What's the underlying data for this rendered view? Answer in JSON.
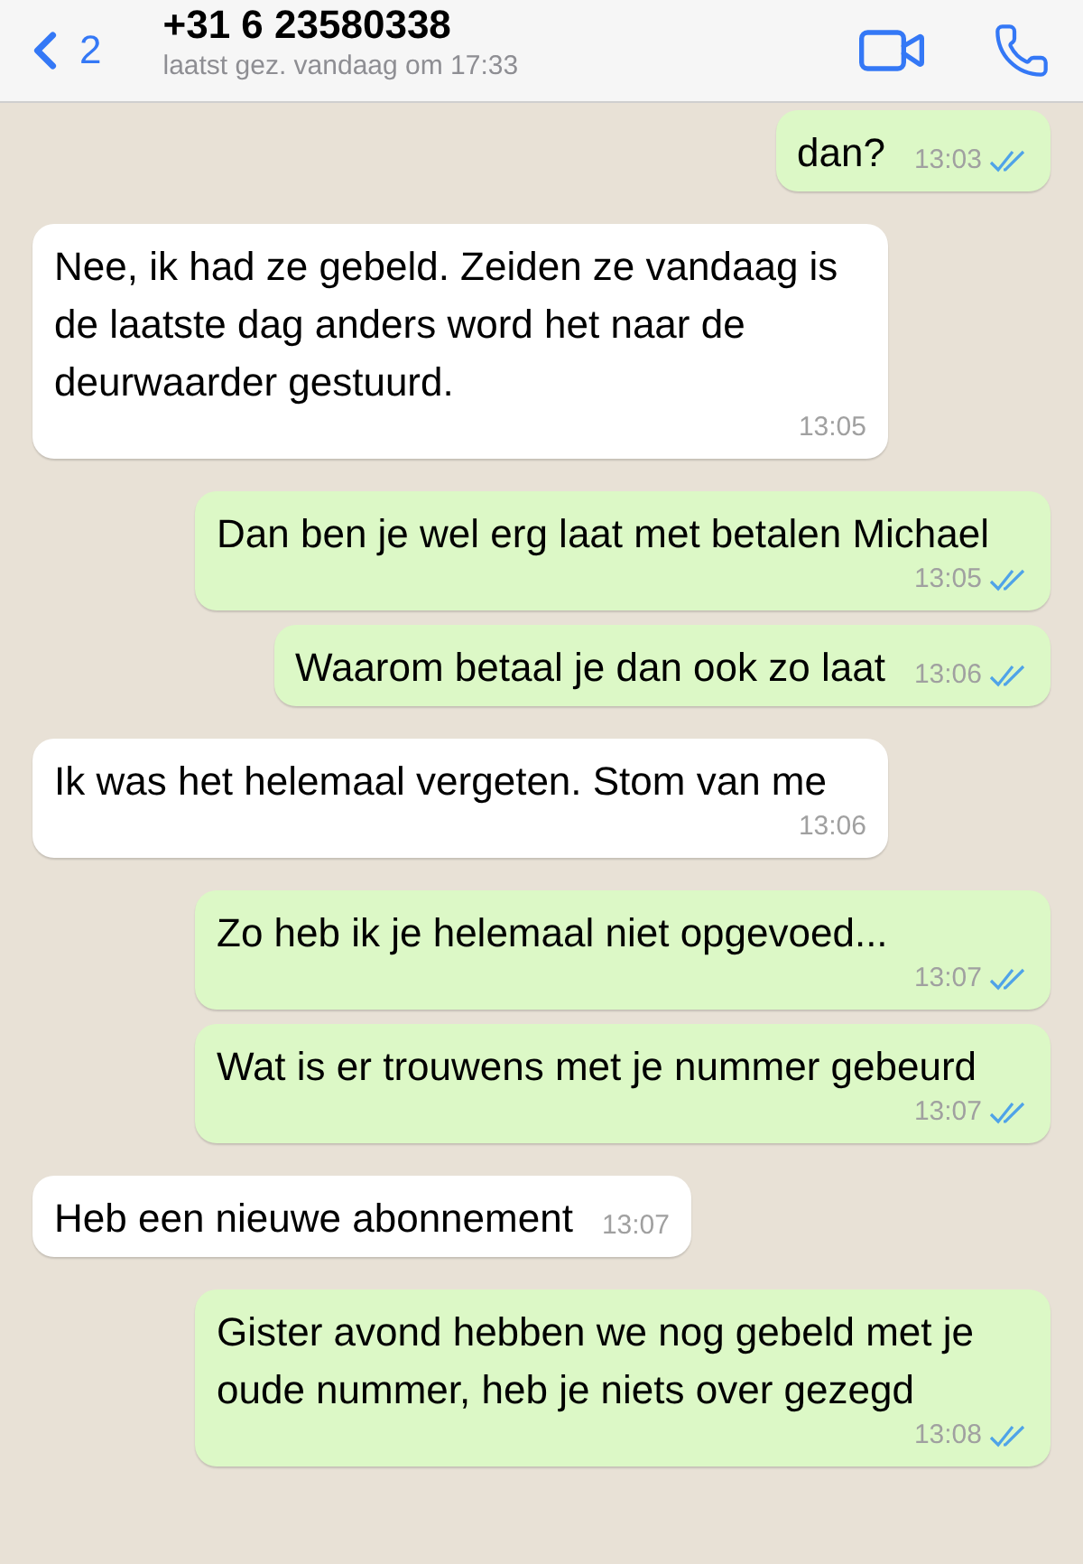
{
  "header": {
    "back_count": "2",
    "contact": "+31 6 23580338",
    "last_seen": "laatst gez. vandaag om 17:33"
  },
  "messages": [
    {
      "kind": "outgoing",
      "text": "dan?",
      "time": "13:03",
      "read": true
    },
    {
      "kind": "incoming",
      "text": "Nee, ik had ze gebeld. Zeiden ze vandaag is de laatste dag anders word het naar de deurwaarder gestuurd.",
      "time": "13:05"
    },
    {
      "kind": "outgoing",
      "text": "Dan ben je wel erg laat met betalen Michael",
      "time": "13:05",
      "read": true
    },
    {
      "kind": "outgoing",
      "text": "Waarom betaal je dan ook zo laat",
      "time": "13:06",
      "read": true
    },
    {
      "kind": "incoming",
      "text": "Ik was het helemaal vergeten. Stom van me",
      "time": "13:06"
    },
    {
      "kind": "outgoing",
      "text": "Zo heb ik je helemaal niet opgevoed...",
      "time": "13:07",
      "read": true
    },
    {
      "kind": "outgoing",
      "text": "Wat is er trouwens met je nummer gebeurd",
      "time": "13:07",
      "read": true
    },
    {
      "kind": "incoming",
      "text": "Heb een nieuwe abonnement",
      "time": "13:07"
    },
    {
      "kind": "outgoing",
      "text": "Gister avond hebben we nog gebeld met je oude nummer, heb je niets over gezegd",
      "time": "13:08",
      "read": true
    }
  ]
}
